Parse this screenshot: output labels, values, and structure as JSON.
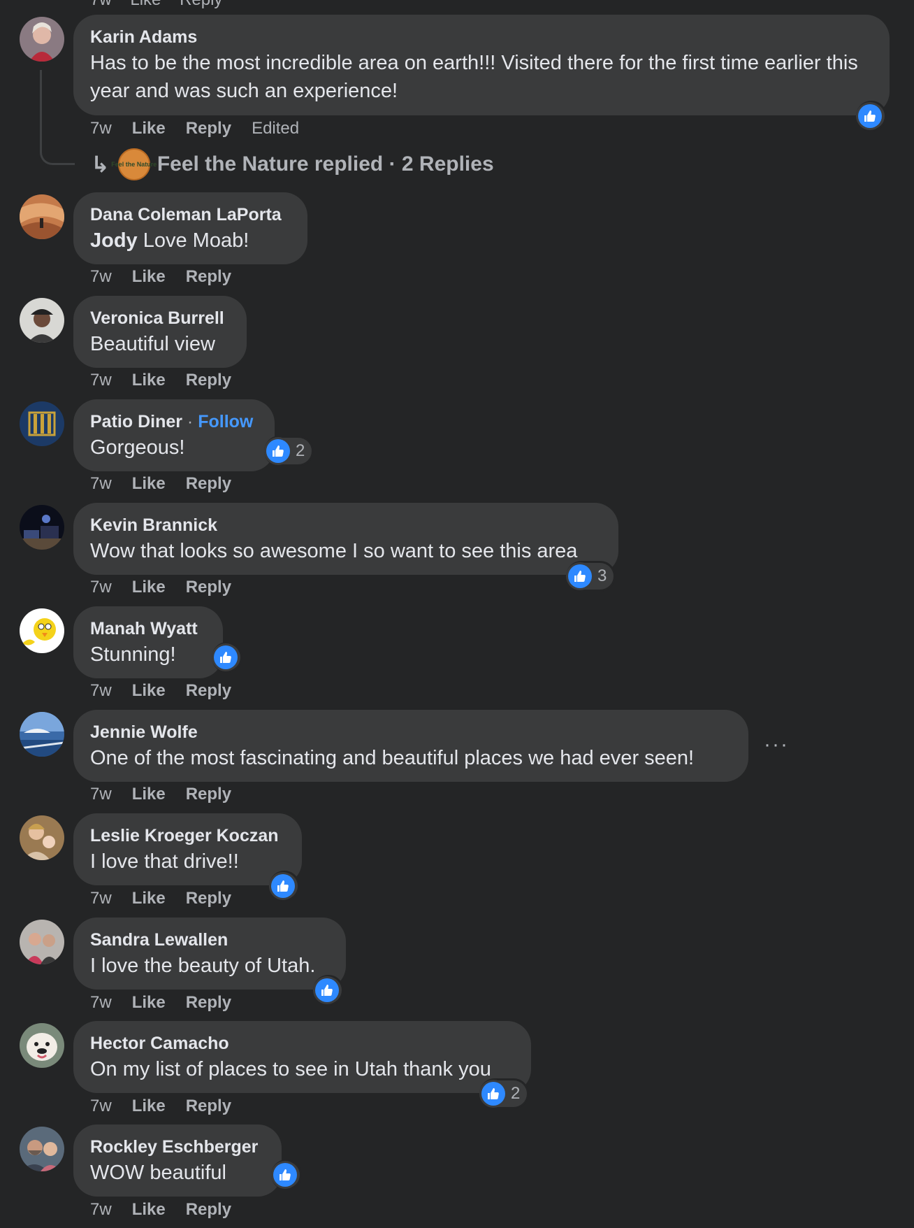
{
  "top_partial_actions": {
    "time": "7w",
    "like": "Like",
    "reply": "Reply"
  },
  "comments": [
    {
      "name": "Karin Adams",
      "text": "Has to be the most incredible area on earth!!! Visited there for the first time earlier this year and was such an experience!",
      "time": "7w",
      "like": "Like",
      "reply": "Reply",
      "edited": "Edited",
      "reaction_count": ""
    },
    {
      "name": "Dana Coleman LaPorta",
      "mention": "Jody",
      "text": " Love Moab!",
      "time": "7w",
      "like": "Like",
      "reply": "Reply"
    },
    {
      "name": "Veronica Burrell",
      "text": "Beautiful view",
      "time": "7w",
      "like": "Like",
      "reply": "Reply"
    },
    {
      "name": "Patio Diner",
      "follow": "Follow",
      "separator": " · ",
      "text": "Gorgeous!",
      "time": "7w",
      "like": "Like",
      "reply": "Reply",
      "reaction_count": "2"
    },
    {
      "name": "Kevin Brannick",
      "text": "Wow that looks so awesome I so want to see this area",
      "time": "7w",
      "like": "Like",
      "reply": "Reply",
      "reaction_count": "3"
    },
    {
      "name": "Manah Wyatt",
      "text": "Stunning!",
      "time": "7w",
      "like": "Like",
      "reply": "Reply",
      "reaction_count": ""
    },
    {
      "name": "Jennie Wolfe",
      "text": "One of the most fascinating and beautiful places we had ever seen!",
      "time": "7w",
      "like": "Like",
      "reply": "Reply"
    },
    {
      "name": "Leslie Kroeger Koczan",
      "text": "I love that drive!!",
      "time": "7w",
      "like": "Like",
      "reply": "Reply",
      "reaction_count": ""
    },
    {
      "name": "Sandra Lewallen",
      "text": "I love the beauty of Utah.",
      "time": "7w",
      "like": "Like",
      "reply": "Reply",
      "reaction_count": ""
    },
    {
      "name": "Hector Camacho",
      "text": "On my list of places to see in Utah thank you",
      "time": "7w",
      "like": "Like",
      "reply": "Reply",
      "reaction_count": "2"
    },
    {
      "name": "Rockley Eschberger",
      "text": "WOW beautiful",
      "time": "7w",
      "like": "Like",
      "reply": "Reply",
      "reaction_count": ""
    }
  ],
  "thread_reply": {
    "page_name": "Feel the Nature",
    "avatar_text": "Feel the Nature",
    "summary": "Feel the Nature replied · 2 Replies"
  },
  "more_menu": "···",
  "colors": {
    "background": "#242526",
    "bubble": "#3a3b3c",
    "like_blue": "#2e89ff",
    "follow_blue": "#4599ff",
    "muted_text": "#b0b3b8"
  },
  "icons": [
    "like-thumb-icon",
    "reply-arrow-icon",
    "more-options-icon"
  ]
}
